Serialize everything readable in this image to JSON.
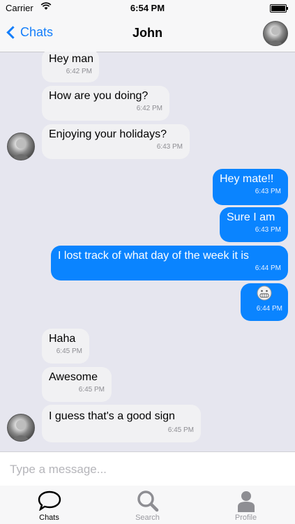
{
  "status": {
    "carrier": "Carrier",
    "time": "6:54 PM",
    "battery_level": 1.0
  },
  "nav": {
    "back_label": "Chats",
    "title": "John"
  },
  "messages": [
    {
      "dir": "in",
      "text": "Hey man",
      "time": "6:42 PM"
    },
    {
      "dir": "in",
      "text": "How are you doing?",
      "time": "6:42 PM"
    },
    {
      "dir": "in",
      "text": "Enjoying your holidays?",
      "time": "6:43 PM"
    },
    {
      "dir": "out",
      "text": "Hey mate!!",
      "time": "6:43 PM"
    },
    {
      "dir": "out",
      "text": "Sure I am",
      "time": "6:43 PM"
    },
    {
      "dir": "out",
      "text": "I lost track of what day of the week it is",
      "time": "6:44 PM"
    },
    {
      "dir": "out",
      "text": "",
      "time": "6:44 PM",
      "emoji": "grimacing-face-icon"
    },
    {
      "dir": "in",
      "text": "Haha",
      "time": "6:45 PM"
    },
    {
      "dir": "in",
      "text": "Awesome",
      "time": "6:45 PM"
    },
    {
      "dir": "in",
      "text": "I guess that's a good sign",
      "time": "6:45 PM"
    }
  ],
  "composer": {
    "placeholder": "Type a message..."
  },
  "tabs": [
    {
      "label": "Chats",
      "icon": "chat-bubble-icon",
      "active": true
    },
    {
      "label": "Search",
      "icon": "search-icon",
      "active": false
    },
    {
      "label": "Profile",
      "icon": "person-icon",
      "active": false
    }
  ],
  "colors": {
    "accent": "#147efb",
    "outgoing_bubble": "#0a84ff",
    "incoming_bubble": "#f1f1f3",
    "background": "#e6e6ef"
  }
}
